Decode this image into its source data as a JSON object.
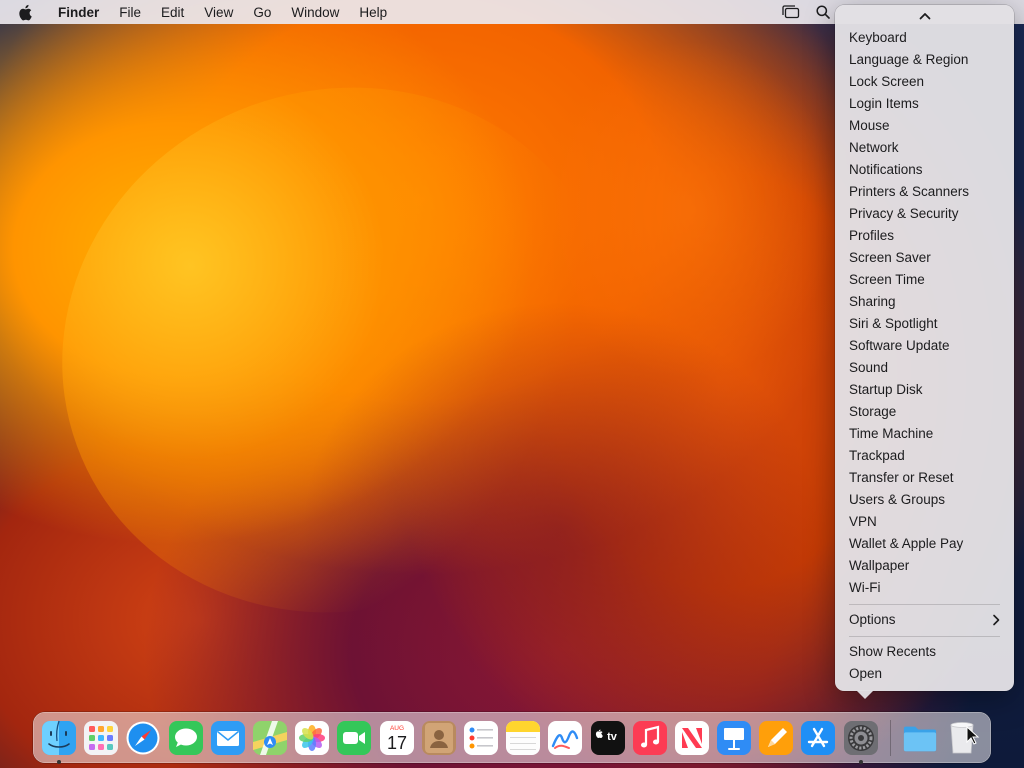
{
  "menubar": {
    "app_name": "Finder",
    "items": [
      "File",
      "Edit",
      "View",
      "Go",
      "Window",
      "Help"
    ]
  },
  "popup_menu": {
    "items": [
      "Keyboard",
      "Language & Region",
      "Lock Screen",
      "Login Items",
      "Mouse",
      "Network",
      "Notifications",
      "Printers & Scanners",
      "Privacy & Security",
      "Profiles",
      "Screen Saver",
      "Screen Time",
      "Sharing",
      "Siri & Spotlight",
      "Software Update",
      "Sound",
      "Startup Disk",
      "Storage",
      "Time Machine",
      "Trackpad",
      "Transfer or Reset",
      "Users & Groups",
      "VPN",
      "Wallet & Apple Pay",
      "Wallpaper",
      "Wi-Fi"
    ],
    "options_label": "Options",
    "show_recents_label": "Show Recents",
    "open_label": "Open"
  },
  "dock": {
    "calendar_month": "AUG",
    "calendar_day": "17",
    "tv_label": "tv",
    "apps": [
      "finder",
      "launchpad",
      "safari",
      "messages",
      "mail",
      "maps",
      "photos",
      "facetime",
      "calendar",
      "contacts",
      "reminders",
      "notes",
      "freeform",
      "tv",
      "music",
      "news",
      "keynote",
      "pages",
      "app-store",
      "system-settings",
      "downloads-folder",
      "trash"
    ]
  }
}
